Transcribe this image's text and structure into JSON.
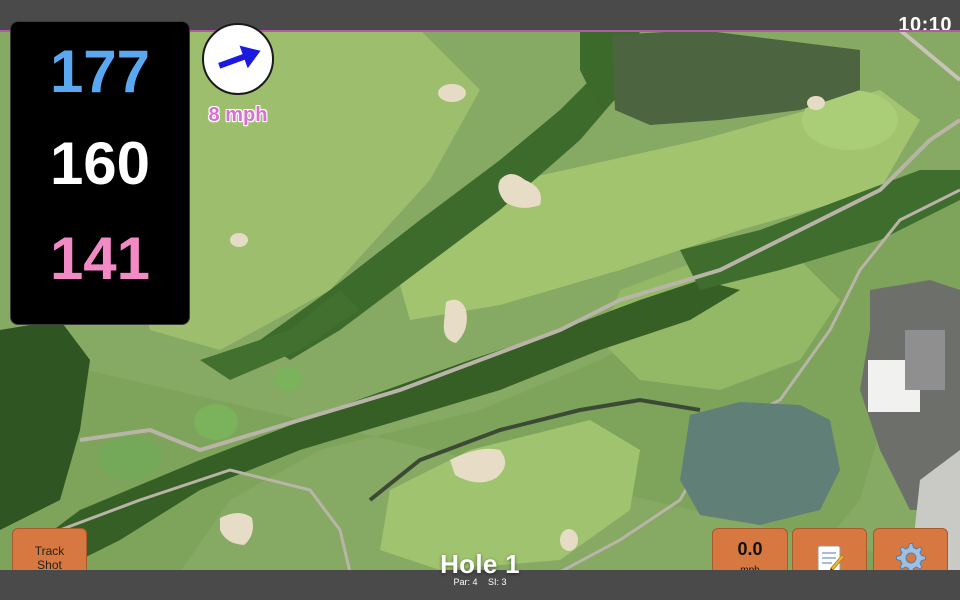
{
  "status": {
    "time": "10:10"
  },
  "distances": {
    "back": "177",
    "middle": "160",
    "front": "141"
  },
  "wind": {
    "speed": "8 mph",
    "direction_icon": "arrow-icon"
  },
  "buttons": {
    "track_shot": "Track\nShot",
    "speed_value": "0.0",
    "speed_unit": "mph",
    "notes_icon": "memo-icon",
    "settings_icon": "gear-icon"
  },
  "hole": {
    "title": "Hole 1",
    "par": "Par: 4",
    "si": "SI: 3"
  },
  "colors": {
    "back": "#5aa8ef",
    "middle": "#ffffff",
    "front": "#f28ac6",
    "wind_text": "#d870cf",
    "button": "#d77840",
    "arrow": "#1a1ae0"
  }
}
